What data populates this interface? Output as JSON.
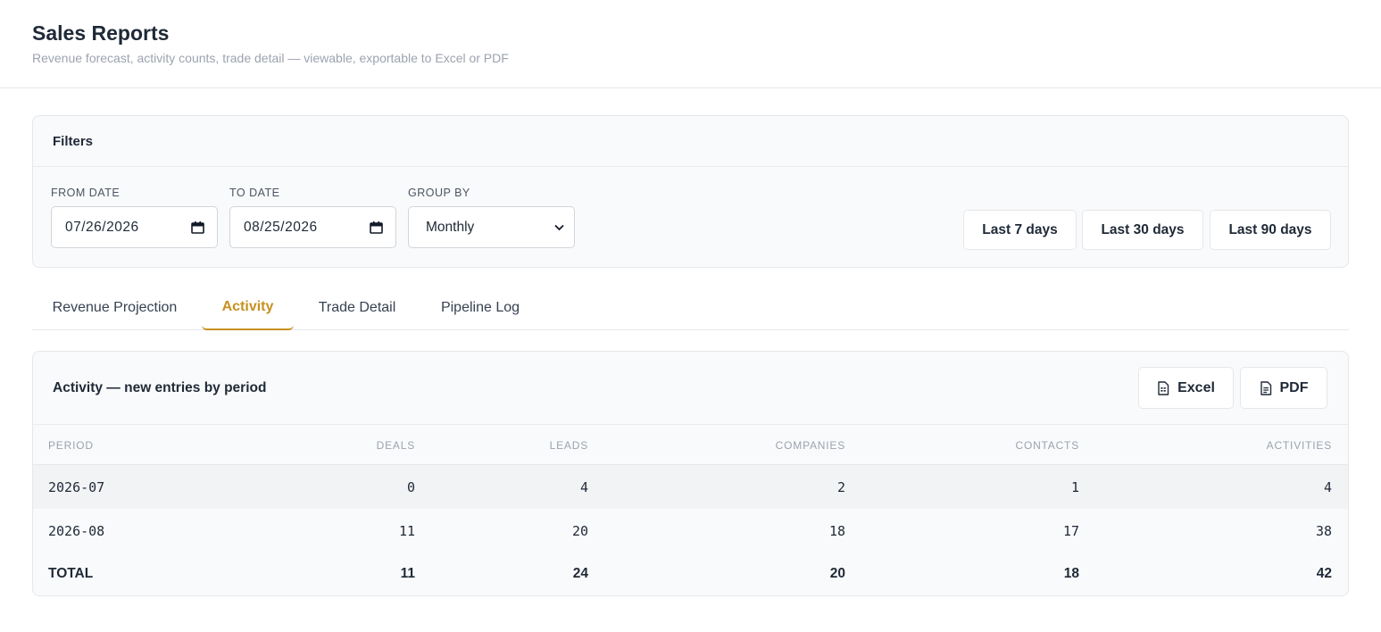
{
  "header": {
    "title": "Sales Reports",
    "subtitle": "Revenue forecast, activity counts, trade detail — viewable, exportable to Excel or PDF"
  },
  "filters": {
    "title": "Filters",
    "from_date": {
      "label": "FROM DATE",
      "value": "07/26/2026"
    },
    "to_date": {
      "label": "TO DATE",
      "value": "08/25/2026"
    },
    "group_by": {
      "label": "GROUP BY",
      "value": "Monthly"
    },
    "presets": [
      "Last 7 days",
      "Last 30 days",
      "Last 90 days"
    ]
  },
  "tabs": [
    {
      "label": "Revenue Projection",
      "active": false
    },
    {
      "label": "Activity",
      "active": true
    },
    {
      "label": "Trade Detail",
      "active": false
    },
    {
      "label": "Pipeline Log",
      "active": false
    }
  ],
  "activity": {
    "title": "Activity — new entries by period",
    "export_excel": "Excel",
    "export_pdf": "PDF",
    "columns": [
      "PERIOD",
      "DEALS",
      "LEADS",
      "COMPANIES",
      "CONTACTS",
      "ACTIVITIES"
    ],
    "rows": [
      [
        "2026-07",
        "0",
        "4",
        "2",
        "1",
        "4"
      ],
      [
        "2026-08",
        "11",
        "20",
        "18",
        "17",
        "38"
      ]
    ],
    "total": [
      "TOTAL",
      "11",
      "24",
      "20",
      "18",
      "42"
    ]
  },
  "colors": {
    "accent": "#c7901f",
    "text": "#1f2937",
    "muted": "#9ca3af",
    "border": "#e5e7eb"
  }
}
